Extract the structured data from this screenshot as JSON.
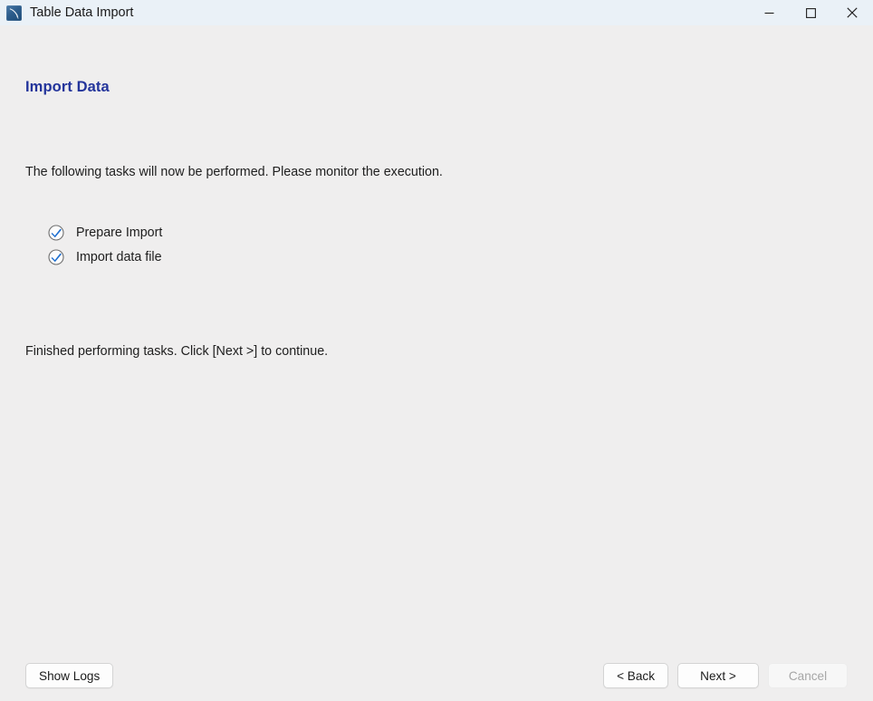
{
  "window": {
    "title": "Table Data Import",
    "icon": "mysql-workbench-dolphin-icon",
    "controls": {
      "minimize": "minimize-icon",
      "maximize": "maximize-icon",
      "close": "close-icon"
    }
  },
  "page": {
    "heading": "Import Data",
    "heading_color": "#23349b",
    "intro": "The following tasks will now be performed. Please monitor the execution.",
    "status": "Finished performing tasks. Click [Next >] to continue."
  },
  "tasks": [
    {
      "label": "Prepare Import",
      "state": "done",
      "icon": "check-circle-icon"
    },
    {
      "label": "Import data file",
      "state": "done",
      "icon": "check-circle-icon"
    }
  ],
  "footer": {
    "show_logs_label": "Show Logs",
    "back_label": "< Back",
    "next_label": "Next >",
    "cancel_label": "Cancel",
    "cancel_disabled": true
  },
  "colors": {
    "titlebar_bg": "#eaf1f7",
    "body_bg": "#efeeee",
    "accent": "#23349b",
    "check_blue": "#1f6fd0",
    "text": "#1d1d1d"
  }
}
